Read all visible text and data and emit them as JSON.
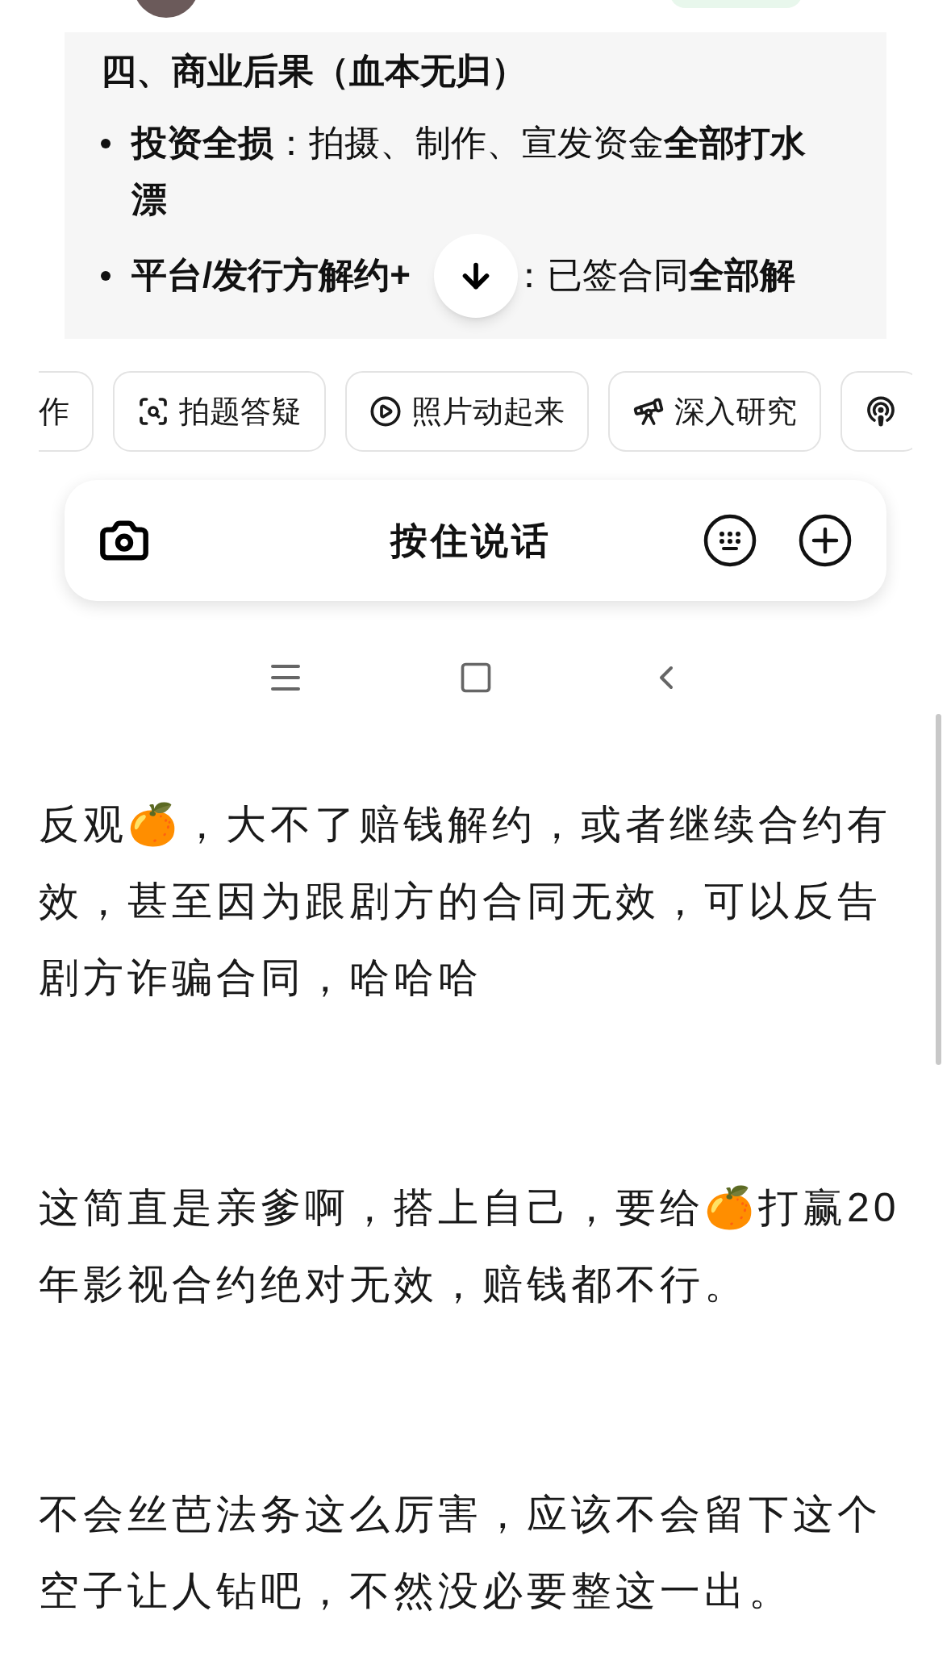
{
  "answer_card": {
    "heading": "四、商业后果（血本无归）",
    "bullets": [
      {
        "label": "投资全损",
        "text": "：拍摄、制作、宣发资金**全部打水漂**"
      },
      {
        "label": "平台/发行方解约+",
        "text": "：已签合同**全部解**"
      }
    ]
  },
  "chips": [
    {
      "kind": "text",
      "label": "作"
    },
    {
      "kind": "icon_text",
      "label": "拍题答疑"
    },
    {
      "kind": "icon_text",
      "label": "照片动起来"
    },
    {
      "kind": "icon_text",
      "label": "深入研究"
    },
    {
      "kind": "icon"
    }
  ],
  "input_bar": {
    "label": "按住说话"
  },
  "paragraphs": [
    "反观🍊，大不了赔钱解约，或者继续合约有效，甚至因为跟剧方的合同无效，可以反告剧方诈骗合同，哈哈哈",
    "这简直是亲爹啊，搭上自己，要给🍊打赢20年影视合约绝对无效，赔钱都不行。",
    "不会丝芭法务这么厉害，应该不会留下这个空子让人钻吧，不然没必要整这一出。"
  ]
}
